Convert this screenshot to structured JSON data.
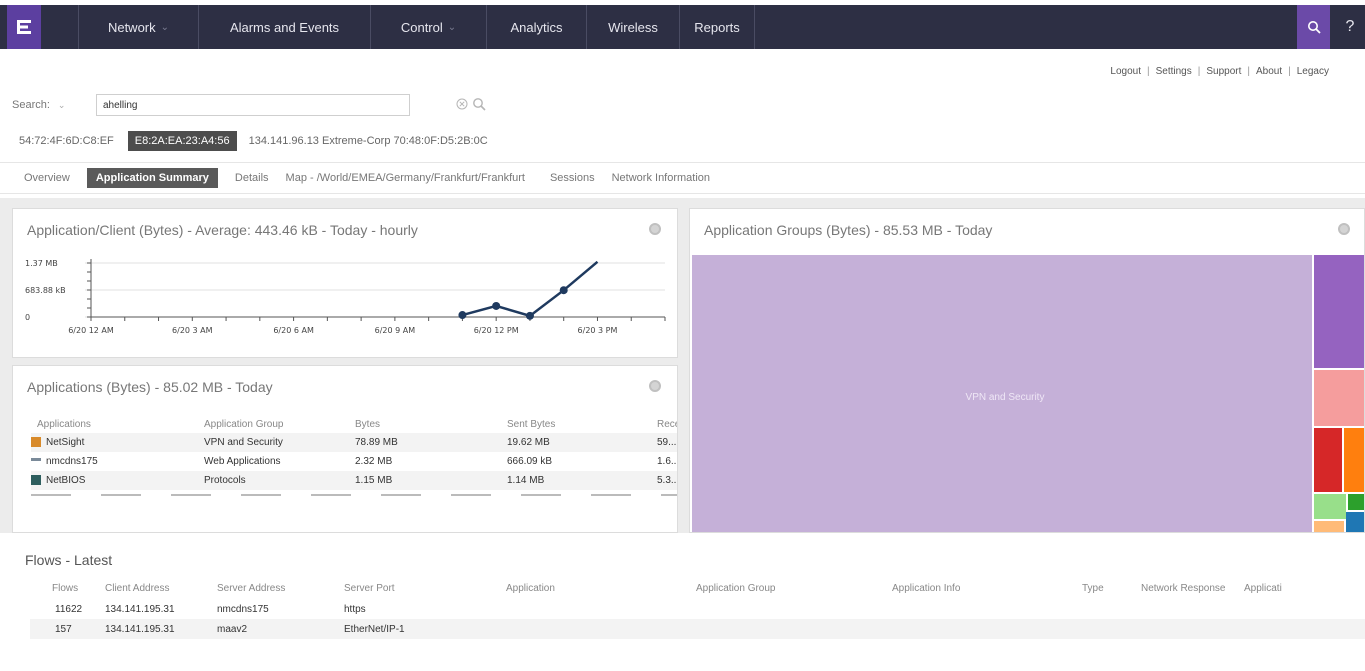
{
  "nav": {
    "logo": "E",
    "items": [
      {
        "label": "Network",
        "has_dropdown": true
      },
      {
        "label": "Alarms and Events",
        "has_dropdown": false
      },
      {
        "label": "Control",
        "has_dropdown": true
      },
      {
        "label": "Analytics",
        "has_dropdown": false
      },
      {
        "label": "Wireless",
        "has_dropdown": false
      },
      {
        "label": "Reports",
        "has_dropdown": false
      }
    ],
    "search_icon": "search-icon",
    "help": "?"
  },
  "utility_links": [
    "Logout",
    "Settings",
    "Support",
    "About",
    "Legacy"
  ],
  "search": {
    "label": "Search:",
    "value": "ahelling"
  },
  "device": {
    "mac": "54:72:4F:6D:C8:EF",
    "selected": "E8:2A:EA:23:A4:56",
    "info": "134.141.96.13 Extreme-Corp 70:48:0F:D5:2B:0C"
  },
  "tabs": [
    {
      "label": "Overview",
      "active": false
    },
    {
      "label": "Application Summary",
      "active": true
    },
    {
      "label": "Details",
      "active": false
    },
    {
      "label": "Map - /World/EMEA/Germany/Frankfurt/Frankfurt",
      "active": false
    },
    {
      "label": "Sessions",
      "active": false
    },
    {
      "label": "Network Information",
      "active": false
    }
  ],
  "client_panel": {
    "title": "Application/Client (Bytes) - Average: 443.46 kB - Today - hourly"
  },
  "chart_data": {
    "type": "line",
    "title": "Application/Client (Bytes) - Average: 443.46 kB - Today - hourly",
    "y_ticks": [
      "1.37 MB",
      "683.88 kB",
      "0"
    ],
    "x_ticks": [
      "6/20 12 AM",
      "6/20 3 AM",
      "6/20 6 AM",
      "6/20 9 AM",
      "6/20 12 PM",
      "6/20 3 PM"
    ],
    "x_hours": [
      11,
      12,
      13,
      14,
      15
    ],
    "y_mb": [
      0.05,
      0.28,
      0.03,
      0.68,
      1.4
    ],
    "ylim": [
      0,
      1.37
    ],
    "xlim_hours": [
      0,
      17
    ],
    "color": "#1f3a5f",
    "grid": true
  },
  "apps_panel": {
    "title": "Applications (Bytes) - 85.02 MB - Today",
    "columns": [
      "Applications",
      "Application Group",
      "Bytes",
      "Sent Bytes",
      "Rece"
    ],
    "rows": [
      {
        "icon": "netsight-icon",
        "icon_color": "#d88a2a",
        "app": "NetSight",
        "group": "VPN and Security",
        "bytes": "78.89 MB",
        "sent": "19.62 MB",
        "recv": "59..."
      },
      {
        "icon": "network-icon",
        "icon_color": "#7a8a99",
        "app": "nmcdns175",
        "group": "Web Applications",
        "bytes": "2.32 MB",
        "sent": "666.09 kB",
        "recv": "1.6..."
      },
      {
        "icon": "netbios-icon",
        "icon_color": "#2e5e5e",
        "app": "NetBIOS",
        "group": "Protocols",
        "bytes": "1.15 MB",
        "sent": "1.14 MB",
        "recv": "5.3..."
      }
    ]
  },
  "groups_panel": {
    "title": "Application Groups (Bytes) - 85.53 MB - Today",
    "main_label": "VPN and Security",
    "colors": {
      "main": "#c5b0d8",
      "purple": "#9563c0",
      "pink": "#f59d9d",
      "red": "#d62728",
      "orange": "#ff7f0e",
      "light_green": "#98df8a",
      "green": "#2ca02c",
      "peach": "#ffbb78",
      "blue": "#1f77b4"
    }
  },
  "flows": {
    "title": "Flows - Latest",
    "columns": [
      "Flows",
      "Client Address",
      "Server Address",
      "Server Port",
      "Application",
      "Application Group",
      "Application Info",
      "Type",
      "Network Response",
      "Applicati"
    ],
    "rows": [
      {
        "flows": "11622",
        "client": "134.141.195.31",
        "server": "nmcdns175",
        "port": "https"
      },
      {
        "flows": "157",
        "client": "134.141.195.31",
        "server": "maav2",
        "port": "EtherNet/IP-1"
      }
    ]
  }
}
